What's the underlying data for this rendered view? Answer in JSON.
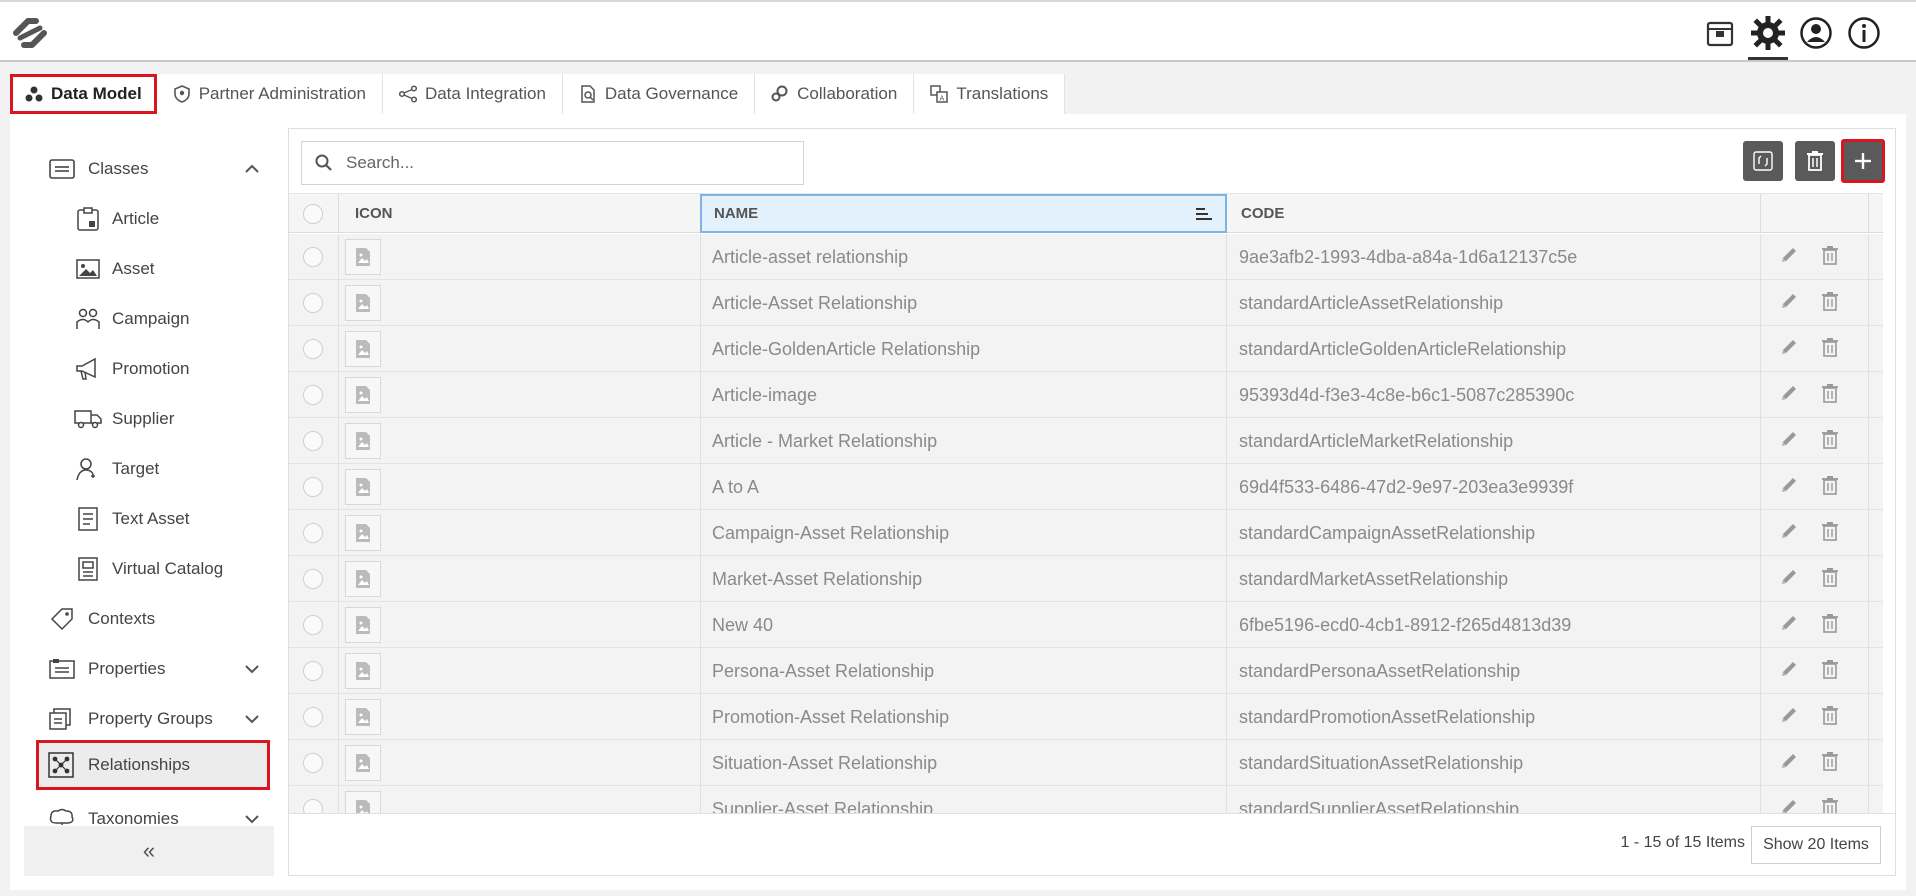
{
  "tabs": [
    {
      "label": "Data Model",
      "icon": "data-model-icon"
    },
    {
      "label": "Partner Administration",
      "icon": "shield-icon"
    },
    {
      "label": "Data Integration",
      "icon": "integration-icon"
    },
    {
      "label": "Data Governance",
      "icon": "governance-icon"
    },
    {
      "label": "Collaboration",
      "icon": "collaboration-icon"
    },
    {
      "label": "Translations",
      "icon": "translations-icon"
    }
  ],
  "sidebar": {
    "items": [
      {
        "label": "Classes",
        "icon": "classes-icon"
      },
      {
        "label": "Article",
        "icon": "article-icon"
      },
      {
        "label": "Asset",
        "icon": "asset-icon"
      },
      {
        "label": "Campaign",
        "icon": "campaign-icon"
      },
      {
        "label": "Promotion",
        "icon": "promotion-icon"
      },
      {
        "label": "Supplier",
        "icon": "supplier-icon"
      },
      {
        "label": "Target",
        "icon": "target-icon"
      },
      {
        "label": "Text Asset",
        "icon": "text-asset-icon"
      },
      {
        "label": "Virtual Catalog",
        "icon": "virtual-catalog-icon"
      },
      {
        "label": "Contexts",
        "icon": "contexts-icon"
      },
      {
        "label": "Properties",
        "icon": "properties-icon"
      },
      {
        "label": "Property Groups",
        "icon": "property-groups-icon"
      },
      {
        "label": "Relationships",
        "icon": "relationships-icon"
      },
      {
        "label": "Taxonomies",
        "icon": "taxonomies-icon"
      }
    ],
    "collapse_label": "«"
  },
  "search": {
    "placeholder": "Search..."
  },
  "grid": {
    "columns": {
      "icon": "ICON",
      "name": "NAME",
      "code": "CODE"
    },
    "rows": [
      {
        "name": "Article-asset relationship",
        "code": "9ae3afb2-1993-4dba-a84a-1d6a12137c5e"
      },
      {
        "name": "Article-Asset Relationship",
        "code": "standardArticleAssetRelationship"
      },
      {
        "name": "Article-GoldenArticle Relationship",
        "code": "standardArticleGoldenArticleRelationship"
      },
      {
        "name": "Article-image",
        "code": "95393d4d-f3e3-4c8e-b6c1-5087c285390c"
      },
      {
        "name": "Article - Market Relationship",
        "code": "standardArticleMarketRelationship"
      },
      {
        "name": "A to A",
        "code": "69d4f533-6486-47d2-9e97-203ea3e9939f"
      },
      {
        "name": "Campaign-Asset Relationship",
        "code": "standardCampaignAssetRelationship"
      },
      {
        "name": "Market-Asset Relationship",
        "code": "standardMarketAssetRelationship"
      },
      {
        "name": "New 40",
        "code": "6fbe5196-ecd0-4cb1-8912-f265d4813d39"
      },
      {
        "name": "Persona-Asset Relationship",
        "code": "standardPersonaAssetRelationship"
      },
      {
        "name": "Promotion-Asset Relationship",
        "code": "standardPromotionAssetRelationship"
      },
      {
        "name": "Situation-Asset Relationship",
        "code": "standardSituationAssetRelationship"
      },
      {
        "name": "Supplier-Asset Relationship",
        "code": "standardSupplierAssetRelationship"
      }
    ]
  },
  "footer": {
    "pager_text": "1 - 15 of 15 Items",
    "show_label": "Show 20 Items"
  },
  "colors": {
    "accent_red": "#d9161f",
    "dark_button": "#5a5a5a",
    "sort_highlight": "#e3f1fc"
  }
}
